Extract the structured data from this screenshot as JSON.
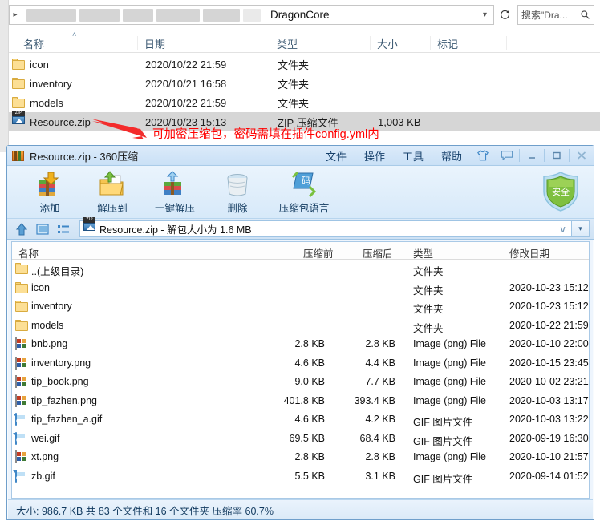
{
  "explorer": {
    "address": {
      "current_path": "DragonCore",
      "chevron_icon": "chevron-right-icon",
      "dropdown_icon": "chevron-down-icon",
      "refresh_icon": "refresh-icon"
    },
    "search": {
      "placeholder": "搜索\"Dra...",
      "icon": "search-icon"
    },
    "columns": [
      "名称",
      "日期",
      "类型",
      "大小",
      "标记"
    ],
    "sort_caret": "˄",
    "rows": [
      {
        "icon": "folder-icon",
        "name": "icon",
        "date": "2020/10/22 21:59",
        "type": "文件夹",
        "size": "",
        "selected": false
      },
      {
        "icon": "folder-icon",
        "name": "inventory",
        "date": "2020/10/21 16:58",
        "type": "文件夹",
        "size": "",
        "selected": false
      },
      {
        "icon": "folder-icon",
        "name": "models",
        "date": "2020/10/22 21:59",
        "type": "文件夹",
        "size": "",
        "selected": false
      },
      {
        "icon": "zip-icon",
        "name": "Resource.zip",
        "date": "2020/10/23 15:13",
        "type": "ZIP 压缩文件",
        "size": "1,003 KB",
        "selected": true
      }
    ],
    "annotation": {
      "text": "可加密压缩包，密码需填在插件config.yml内",
      "color": "#ff0000",
      "arrow_icon": "red-arrow-icon"
    }
  },
  "archive": {
    "titlebar": {
      "title": "Resource.zip - 360压缩",
      "app_icon": "archive-icon",
      "menus": [
        "文件",
        "操作",
        "工具",
        "帮助"
      ],
      "skin_icon": "tshirt-skin-icon",
      "feedback_icon": "feedback-icon",
      "minimize_icon": "minimize-icon",
      "maximize_icon": "maximize-icon",
      "close_icon": "close-icon"
    },
    "toolbar": {
      "buttons": [
        {
          "label": "添加",
          "icon": "add-to-archive-icon"
        },
        {
          "label": "解压到",
          "icon": "extract-to-icon"
        },
        {
          "label": "一键解压",
          "icon": "one-click-extract-icon"
        },
        {
          "label": "删除",
          "icon": "delete-icon"
        },
        {
          "label": "压缩包语言",
          "icon": "archive-language-icon"
        }
      ],
      "shield": {
        "label": "安全",
        "icon": "security-shield-icon",
        "color": "#7bc043"
      }
    },
    "pathbar": {
      "up_icon": "up-arrow-icon",
      "preview_icon": "preview-pane-icon",
      "listview_icon": "list-view-icon",
      "file_icon": "zip-icon",
      "text": "Resource.zip - 解包大小为 1.6 MB",
      "dropdown_icon": "chevron-down-icon",
      "v_mark": "∨"
    },
    "columns": [
      "名称",
      "压缩前",
      "压缩后",
      "类型",
      "修改日期"
    ],
    "rows": [
      {
        "icon": "folder-icon",
        "name": "..(上级目录)",
        "pre": "",
        "post": "",
        "type": "文件夹",
        "date": ""
      },
      {
        "icon": "folder-icon",
        "name": "icon",
        "pre": "",
        "post": "",
        "type": "文件夹",
        "date": "2020-10-23 15:12"
      },
      {
        "icon": "folder-icon",
        "name": "inventory",
        "pre": "",
        "post": "",
        "type": "文件夹",
        "date": "2020-10-23 15:12"
      },
      {
        "icon": "folder-icon",
        "name": "models",
        "pre": "",
        "post": "",
        "type": "文件夹",
        "date": "2020-10-22 21:59"
      },
      {
        "icon": "png-icon",
        "name": "bnb.png",
        "pre": "2.8 KB",
        "post": "2.8 KB",
        "type": "Image (png) File",
        "date": "2020-10-10 22:00"
      },
      {
        "icon": "png-icon",
        "name": "inventory.png",
        "pre": "4.6 KB",
        "post": "4.4 KB",
        "type": "Image (png) File",
        "date": "2020-10-15 23:45"
      },
      {
        "icon": "png-icon",
        "name": "tip_book.png",
        "pre": "9.0 KB",
        "post": "7.7 KB",
        "type": "Image (png) File",
        "date": "2020-10-02 23:21"
      },
      {
        "icon": "png-icon",
        "name": "tip_fazhen.png",
        "pre": "401.8 KB",
        "post": "393.4 KB",
        "type": "Image (png) File",
        "date": "2020-10-03 13:17"
      },
      {
        "icon": "gif-icon",
        "name": "tip_fazhen_a.gif",
        "pre": "4.6 KB",
        "post": "4.2 KB",
        "type": "GIF 图片文件",
        "date": "2020-10-03 13:22"
      },
      {
        "icon": "gif-icon",
        "name": "wei.gif",
        "pre": "69.5 KB",
        "post": "68.4 KB",
        "type": "GIF 图片文件",
        "date": "2020-09-19 16:30"
      },
      {
        "icon": "png-icon",
        "name": "xt.png",
        "pre": "2.8 KB",
        "post": "2.8 KB",
        "type": "Image (png) File",
        "date": "2020-10-10 21:57"
      },
      {
        "icon": "gif-icon",
        "name": "zb.gif",
        "pre": "5.5 KB",
        "post": "3.1 KB",
        "type": "GIF 图片文件",
        "date": "2020-09-14 01:52"
      }
    ],
    "statusbar": "大小: 986.7 KB 共 83 个文件和 16 个文件夹 压缩率 60.7%"
  }
}
